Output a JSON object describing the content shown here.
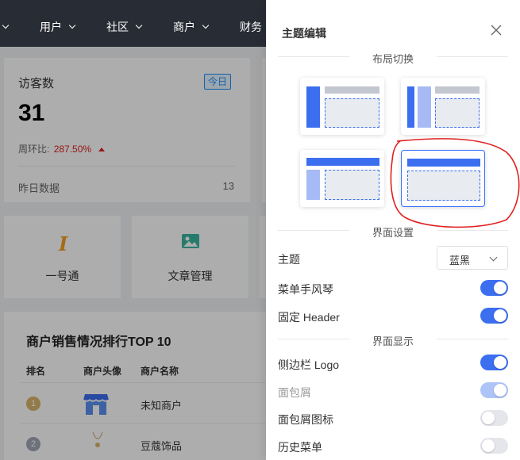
{
  "nav": {
    "items": [
      {
        "label": ""
      },
      {
        "label": "用户"
      },
      {
        "label": "社区"
      },
      {
        "label": "商户"
      },
      {
        "label": "财务"
      }
    ]
  },
  "stats": {
    "title": "访客数",
    "tag": "今日",
    "value": "31",
    "ratio_label": "周环比:",
    "ratio_value": "287.50%",
    "foot_label": "昨日数据",
    "foot_value": "13"
  },
  "shortcuts": [
    {
      "label": "一号通",
      "icon": "cursor-i-icon"
    },
    {
      "label": "文章管理",
      "icon": "image-icon"
    }
  ],
  "ranking": {
    "title": "商户销售情况排行TOP 10",
    "headers": [
      "排名",
      "商户头像",
      "商户名称"
    ],
    "rows": [
      {
        "rank": "1",
        "name": "未知商户"
      },
      {
        "rank": "2",
        "name": "豆蔻饰品"
      }
    ]
  },
  "drawer": {
    "title": "主题编辑",
    "sections": {
      "layout": "布局切换",
      "interface": "界面设置",
      "display": "界面显示"
    },
    "settings": {
      "theme_label": "主题",
      "theme_value": "蓝黑",
      "accordion_label": "菜单手风琴",
      "accordion_on": true,
      "fixed_header_label": "固定 Header",
      "fixed_header_on": true,
      "sidebar_logo_label": "侧边栏 Logo",
      "sidebar_logo_on": true,
      "breadcrumb_label": "面包屑",
      "breadcrumb_on": true,
      "breadcrumb_icon_label": "面包屑图标",
      "breadcrumb_icon_on": false,
      "history_menu_label": "历史菜单",
      "history_menu_on": false
    },
    "layout_options": [
      "sidebar-classic",
      "sidebar-double",
      "top-side",
      "top-only"
    ],
    "active_layout": "top-only"
  },
  "colors": {
    "accent": "#3c6ef0",
    "danger": "#e02020",
    "annotation": "#e02020"
  }
}
